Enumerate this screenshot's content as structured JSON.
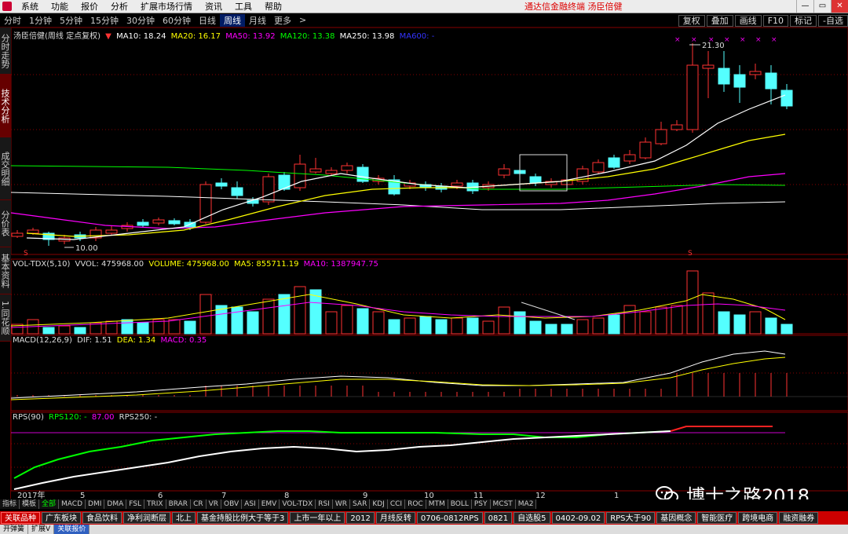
{
  "menu": [
    "系统",
    "功能",
    "报价",
    "分析",
    "扩展市场行情",
    "资讯",
    "工具",
    "帮助"
  ],
  "promo_text": "通达信金融终端   汤臣倍健",
  "window_buttons": [
    "—",
    "▭",
    "✕"
  ],
  "periods": [
    "分时",
    "1分钟",
    "5分钟",
    "15分钟",
    "30分钟",
    "60分钟",
    "日线",
    "周线",
    "月线",
    "更多",
    ">"
  ],
  "active_period": "周线",
  "right_tools": [
    "复权",
    "叠加",
    "画线",
    "F10",
    "标记",
    "-自选"
  ],
  "vertical_tabs": [
    "分时走势",
    "技术分析",
    "成交明细",
    "分价表",
    "基本资料",
    "1.同花顺"
  ],
  "active_vtab": "技术分析",
  "kline_legend": {
    "title": "汤臣倍健(周线 定点复权)",
    "ma10": "MA10: 18.24",
    "ma20": "MA20: 16.17",
    "ma50": "MA50: 13.92",
    "ma120": "MA120: 13.38",
    "ma250": "MA250: 13.98",
    "ma600": "MA600: -"
  },
  "high_label": "21.30",
  "low_label": "10.00",
  "vol_legend": {
    "name": "VOL-TDX(5,10)",
    "vvol": "VVOL: 475968.00",
    "volume": "VOLUME: 475968.00",
    "ma5": "MA5: 855711.19",
    "ma10": "MA10: 1387947.75"
  },
  "macd_legend": {
    "name": "MACD(12,26,9)",
    "dif": "DIF: 1.51",
    "dea": "DEA: 1.34",
    "macd": "MACD: 0.35"
  },
  "rps_legend": {
    "name": "RPS(90)",
    "rps120": "RPS120: -",
    "value": "87.00",
    "rps250": "RPS250: -"
  },
  "time_axis": [
    "2017年",
    "5",
    "6",
    "7",
    "8",
    "9",
    "10",
    "11",
    "12",
    "1"
  ],
  "indicator_tabs": [
    "指标",
    "模板",
    "全部",
    "MACD",
    "DMI",
    "DMA",
    "FSL",
    "TRIX",
    "BRAR",
    "CR",
    "VR",
    "OBV",
    "ASI",
    "EMV",
    "VOL-TDX",
    "RSI",
    "WR",
    "SAR",
    "KDJ",
    "CCI",
    "ROC",
    "MTM",
    "BOLL",
    "PSY",
    "MCST",
    "MA2"
  ],
  "active_indicator": "全部",
  "sectors": [
    "关联品种",
    "广东板块",
    "食品饮料",
    "净利润断层",
    "北上",
    "基金持股比例大于等于3",
    "上市一年以上",
    "2012",
    "月线反转",
    "0706-0812RPS",
    "0821",
    "自选股5",
    "0402-09.02",
    "RPS大于90",
    "基因概念",
    "智能医疗",
    "跨境电商",
    "融资融券"
  ],
  "status": [
    "开弹簧",
    "扩展V",
    "关联报价"
  ],
  "watermark": "博士之路2018",
  "colors": {
    "up": "#ff3232",
    "down": "#54ffff",
    "ma10": "#ffffff",
    "ma20": "#ffff00",
    "ma50": "#ff00ff",
    "ma120": "#00ff00",
    "ma250": "#ffffff",
    "accent": "#c00000"
  }
}
